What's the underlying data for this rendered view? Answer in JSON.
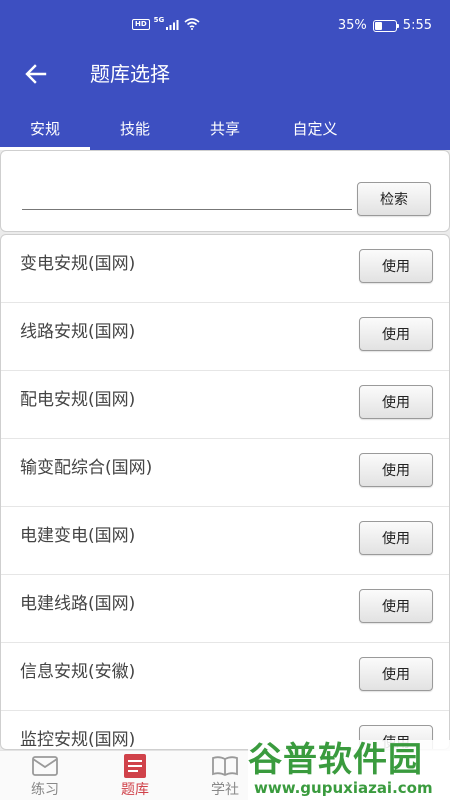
{
  "status_bar": {
    "hd": "HD",
    "network": "5G",
    "battery": "35%",
    "battery_level": 0.35,
    "time": "5:55"
  },
  "header": {
    "back_icon": "arrow-left-icon",
    "title": "题库选择",
    "accent_color": "#3d4fc1"
  },
  "tabs": [
    {
      "label": "安规",
      "active": true
    },
    {
      "label": "技能",
      "active": false
    },
    {
      "label": "共享",
      "active": false
    },
    {
      "label": "自定义",
      "active": false
    }
  ],
  "search": {
    "value": "",
    "button_label": "检索"
  },
  "banks": [
    {
      "name": "变电安规(国网)",
      "button_label": "使用"
    },
    {
      "name": "线路安规(国网)",
      "button_label": "使用"
    },
    {
      "name": "配电安规(国网)",
      "button_label": "使用"
    },
    {
      "name": "输变配综合(国网)",
      "button_label": "使用"
    },
    {
      "name": "电建变电(国网)",
      "button_label": "使用"
    },
    {
      "name": "电建线路(国网)",
      "button_label": "使用"
    },
    {
      "name": "信息安规(安徽)",
      "button_label": "使用"
    },
    {
      "name": "监控安规(国网)",
      "button_label": "使用"
    }
  ],
  "bottom_nav": [
    {
      "label": "练习",
      "icon": "envelope-icon",
      "active": false
    },
    {
      "label": "题库",
      "icon": "document-list-icon",
      "active": true
    },
    {
      "label": "学社",
      "icon": "open-book-icon",
      "active": false
    }
  ],
  "watermark": {
    "logo": "谷普软件园",
    "url": "www.gupuxiazai.com"
  }
}
